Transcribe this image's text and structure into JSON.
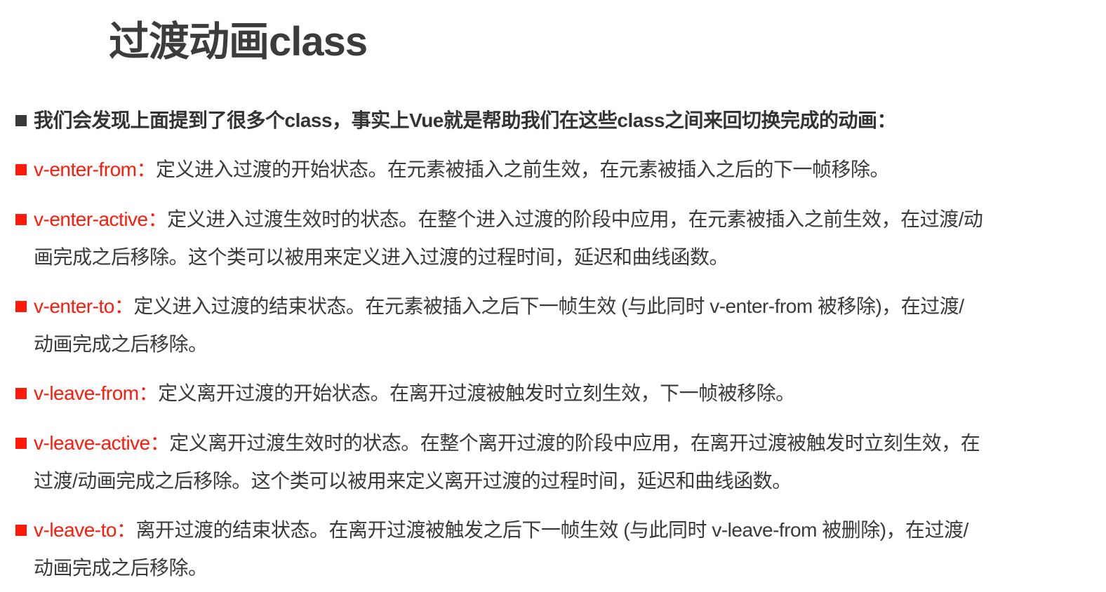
{
  "title": "过渡动画class",
  "intro": "我们会发现上面提到了很多个class，事实上Vue就是帮助我们在这些class之间来回切换完成的动画：",
  "colors": {
    "accent": "#ff1a0a",
    "text": "#3a3a3a"
  },
  "items": [
    {
      "name": "v-enter-from",
      "sep": "：",
      "lines": [
        "定义进入过渡的开始状态。在元素被插入之前生效，在元素被插入之后的下一帧移除。"
      ]
    },
    {
      "name": "v-enter-active",
      "sep": "：",
      "lines": [
        "定义进入过渡生效时的状态。在整个进入过渡的阶段中应用，在元素被插入之前生效，在过渡/动",
        "画完成之后移除。这个类可以被用来定义进入过渡的过程时间，延迟和曲线函数。"
      ]
    },
    {
      "name": "v-enter-to",
      "sep": "：",
      "lines": [
        "定义进入过渡的结束状态。在元素被插入之后下一帧生效 (与此同时 v-enter-from 被移除)，在过渡/",
        "动画完成之后移除。"
      ]
    },
    {
      "name": "v-leave-from",
      "sep": "：",
      "lines": [
        "定义离开过渡的开始状态。在离开过渡被触发时立刻生效，下一帧被移除。"
      ]
    },
    {
      "name": "v-leave-active",
      "sep": "：",
      "lines": [
        "定义离开过渡生效时的状态。在整个离开过渡的阶段中应用，在离开过渡被触发时立刻生效，在",
        "过渡/动画完成之后移除。这个类可以被用来定义离开过渡的过程时间，延迟和曲线函数。"
      ]
    },
    {
      "name": "v-leave-to",
      "sep": "：",
      "lines": [
        "离开过渡的结束状态。在离开过渡被触发之后下一帧生效 (与此同时 v-leave-from 被删除)，在过渡/",
        "动画完成之后移除。"
      ]
    }
  ]
}
